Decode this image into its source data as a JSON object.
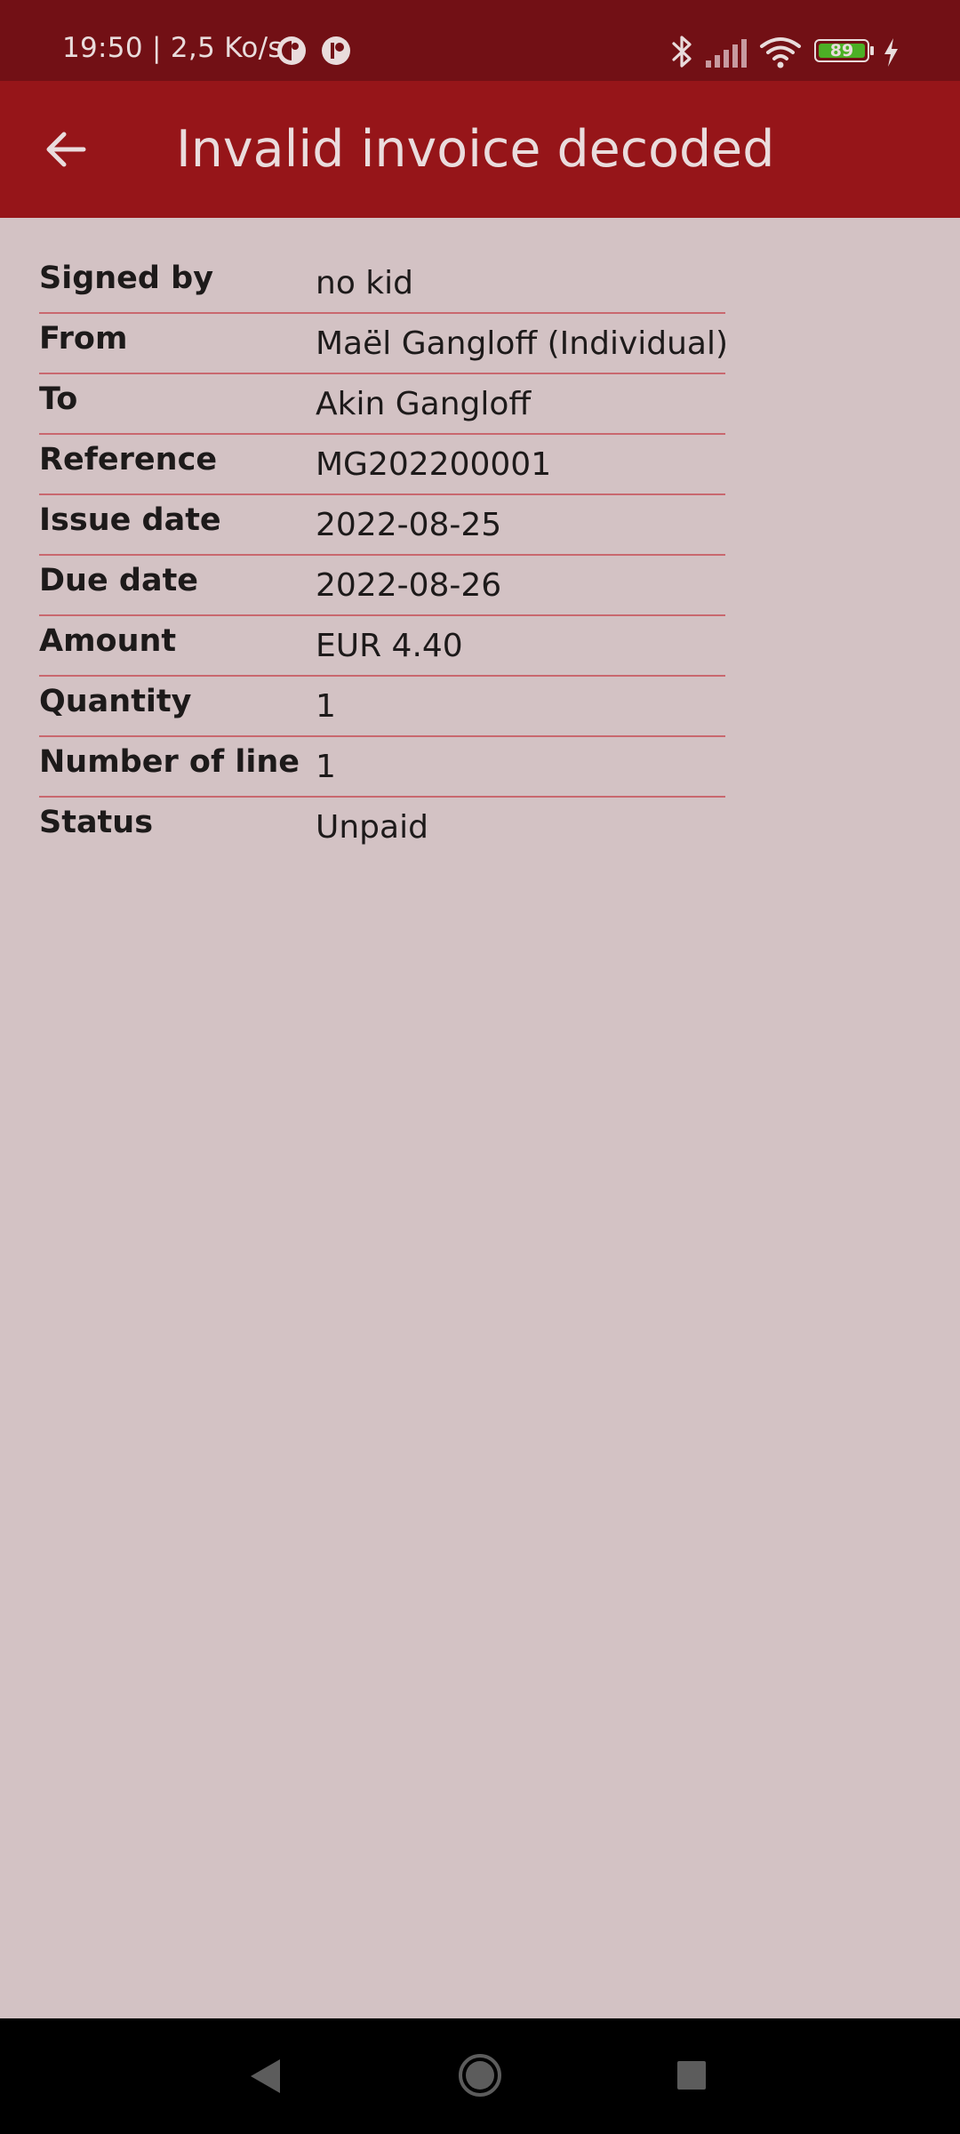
{
  "status_bar": {
    "time_speed": "19:50 | 2,5 Ko/s",
    "battery_level": "89",
    "icons": [
      "notification-icon",
      "notification-icon",
      "bluetooth-icon",
      "signal-icon",
      "wifi-icon",
      "battery-icon",
      "charging-icon"
    ]
  },
  "app_bar": {
    "title": "Invalid invoice decoded",
    "back_icon": "arrow-back-icon"
  },
  "details": [
    {
      "label": "Signed by",
      "value": "no kid"
    },
    {
      "label": "From",
      "value": "Maël Gangloff (Individual)"
    },
    {
      "label": "To",
      "value": "Akin Gangloff"
    },
    {
      "label": "Reference",
      "value": "MG202200001"
    },
    {
      "label": "Issue date",
      "value": "2022-08-25"
    },
    {
      "label": "Due date",
      "value": "2022-08-26"
    },
    {
      "label": "Amount",
      "value": "EUR 4.40"
    },
    {
      "label": "Quantity",
      "value": "1"
    },
    {
      "label": "Number of line",
      "value": "1"
    },
    {
      "label": "Status",
      "value": "Unpaid"
    }
  ],
  "nav_bar": {
    "icons": [
      "nav-back-icon",
      "nav-home-icon",
      "nav-recents-icon"
    ]
  },
  "colors": {
    "status_bar_bg": "#721015",
    "app_bar_bg": "#961519",
    "page_bg": "#d3c2c4",
    "row_divider": "#c9686f",
    "battery_fill": "#4caf25"
  }
}
